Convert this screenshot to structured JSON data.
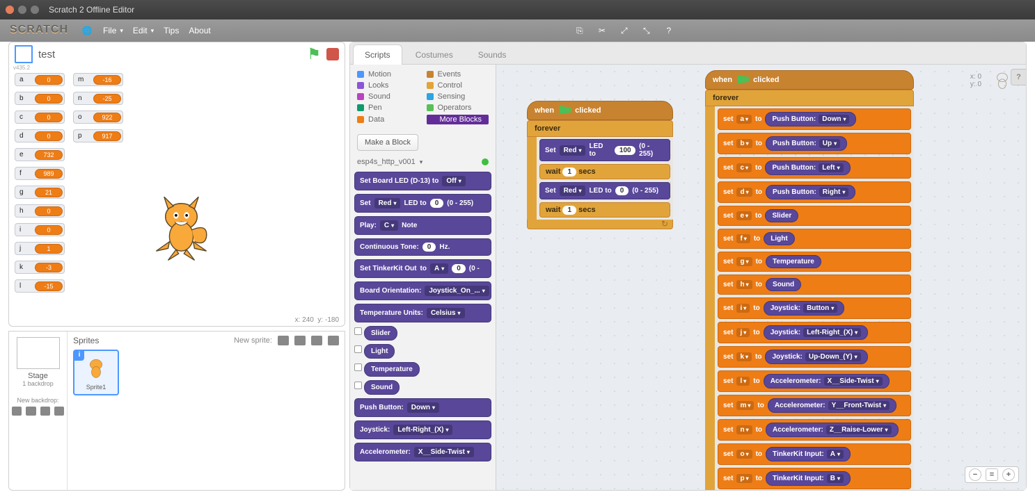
{
  "window": {
    "title": "Scratch 2 Offline Editor"
  },
  "menubar": {
    "logo": "SCRATCH",
    "items": {
      "file": "File",
      "edit": "Edit",
      "tips": "Tips",
      "about": "About"
    }
  },
  "stage": {
    "title": "test",
    "version": "v435.2",
    "mouse": {
      "xlabel": "x:",
      "x": "240",
      "ylabel": "y:",
      "y": "-180"
    }
  },
  "vars_col1": [
    {
      "n": "a",
      "v": "0"
    },
    {
      "n": "b",
      "v": "0"
    },
    {
      "n": "c",
      "v": "0"
    },
    {
      "n": "d",
      "v": "0"
    },
    {
      "n": "e",
      "v": "732"
    },
    {
      "n": "f",
      "v": "989"
    },
    {
      "n": "g",
      "v": "21"
    },
    {
      "n": "h",
      "v": "0"
    },
    {
      "n": "i",
      "v": "0"
    },
    {
      "n": "j",
      "v": "1"
    },
    {
      "n": "k",
      "v": "-3"
    },
    {
      "n": "l",
      "v": "-15"
    }
  ],
  "vars_col2": [
    {
      "n": "m",
      "v": "-16"
    },
    {
      "n": "n",
      "v": "-25"
    },
    {
      "n": "o",
      "v": "922"
    },
    {
      "n": "p",
      "v": "917"
    }
  ],
  "sprite_panel": {
    "title": "Sprites",
    "new_sprite": "New sprite:",
    "stage_label": "Stage",
    "backdrop_count": "1 backdrop",
    "new_backdrop": "New backdrop:",
    "sprite_name": "Sprite1"
  },
  "tabs": {
    "scripts": "Scripts",
    "costumes": "Costumes",
    "sounds": "Sounds"
  },
  "categories": [
    {
      "label": "Motion",
      "color": "#4c97ff"
    },
    {
      "label": "Events",
      "color": "#c88330"
    },
    {
      "label": "Looks",
      "color": "#8a55d7"
    },
    {
      "label": "Control",
      "color": "#e1a43b"
    },
    {
      "label": "Sound",
      "color": "#bb42c3"
    },
    {
      "label": "Sensing",
      "color": "#2ca5e2"
    },
    {
      "label": "Pen",
      "color": "#0e9a6c"
    },
    {
      "label": "Operators",
      "color": "#59c059"
    },
    {
      "label": "Data",
      "color": "#ee7d16"
    },
    {
      "label": "More Blocks",
      "color": "#632d99",
      "selected": true
    }
  ],
  "make_block": "Make a Block",
  "extension": {
    "name": "esp4s_http_v001"
  },
  "palette_blocks": {
    "b1": {
      "pre": "Set Board LED (D-13) to",
      "dd": "Off"
    },
    "b2": {
      "pre": "Set",
      "dd1": "Red",
      "mid": "LED to",
      "num": "0",
      "post": "(0 - 255)"
    },
    "b3": {
      "pre": "Play:",
      "dd": "C",
      "post": "Note"
    },
    "b4": {
      "pre": "Continuous Tone:",
      "num": "0",
      "post": "Hz."
    },
    "b5": {
      "pre": "Set TinkerKit Out",
      "dd": "A",
      "mid": "to",
      "num": "0",
      "post": "(0 -"
    },
    "b6": {
      "pre": "Board Orientation:",
      "dd": "Joystick_On_..."
    },
    "b7": {
      "pre": "Temperature Units:",
      "dd": "Celsius"
    },
    "r1": "Slider",
    "r2": "Light",
    "r3": "Temperature",
    "r4": "Sound",
    "b8": {
      "pre": "Push Button:",
      "dd": "Down"
    },
    "b9": {
      "pre": "Joystick:",
      "dd": "Left-Right_(X)"
    },
    "b10": {
      "pre": "Accelerometer:",
      "dd": "X__Side-Twist"
    }
  },
  "script_a": {
    "hat": "clicked",
    "when": "when",
    "forever": "forever",
    "row1": {
      "pre": "Set",
      "dd": "Red",
      "mid": "LED to",
      "num": "100",
      "post": "(0 - 255)"
    },
    "wait": {
      "pre": "wait",
      "num": "1",
      "post": "secs"
    },
    "row2": {
      "pre": "Set",
      "dd": "Red",
      "mid": "LED to",
      "num": "0",
      "post": "(0 - 255)"
    }
  },
  "script_b": {
    "hat": "clicked",
    "when": "when",
    "forever": "forever",
    "rows": [
      {
        "v": "a",
        "r": {
          "t": "Push Button:",
          "d": "Down"
        }
      },
      {
        "v": "b",
        "r": {
          "t": "Push Button:",
          "d": "Up"
        }
      },
      {
        "v": "c",
        "r": {
          "t": "Push Button:",
          "d": "Left"
        }
      },
      {
        "v": "d",
        "r": {
          "t": "Push Button:",
          "d": "Right"
        }
      },
      {
        "v": "e",
        "r": {
          "t": "Slider"
        }
      },
      {
        "v": "f",
        "r": {
          "t": "Light"
        }
      },
      {
        "v": "g",
        "r": {
          "t": "Temperature"
        }
      },
      {
        "v": "h",
        "r": {
          "t": "Sound"
        }
      },
      {
        "v": "i",
        "r": {
          "t": "Joystick:",
          "d": "Button"
        }
      },
      {
        "v": "j",
        "r": {
          "t": "Joystick:",
          "d": "Left-Right_(X)"
        }
      },
      {
        "v": "k",
        "r": {
          "t": "Joystick:",
          "d": "Up-Down_(Y)"
        }
      },
      {
        "v": "l",
        "r": {
          "t": "Accelerometer:",
          "d": "X__Side-Twist"
        }
      },
      {
        "v": "m",
        "r": {
          "t": "Accelerometer:",
          "d": "Y__Front-Twist"
        }
      },
      {
        "v": "n",
        "r": {
          "t": "Accelerometer:",
          "d": "Z__Raise-Lower"
        }
      },
      {
        "v": "o",
        "r": {
          "t": "TinkerKit Input:",
          "d": "A"
        }
      },
      {
        "v": "p",
        "r": {
          "t": "TinkerKit Input:",
          "d": "B"
        }
      }
    ],
    "set": "set",
    "to": "to"
  },
  "sprite_info": {
    "x_label": "x:",
    "x": "0",
    "y_label": "y:",
    "y": "0"
  }
}
